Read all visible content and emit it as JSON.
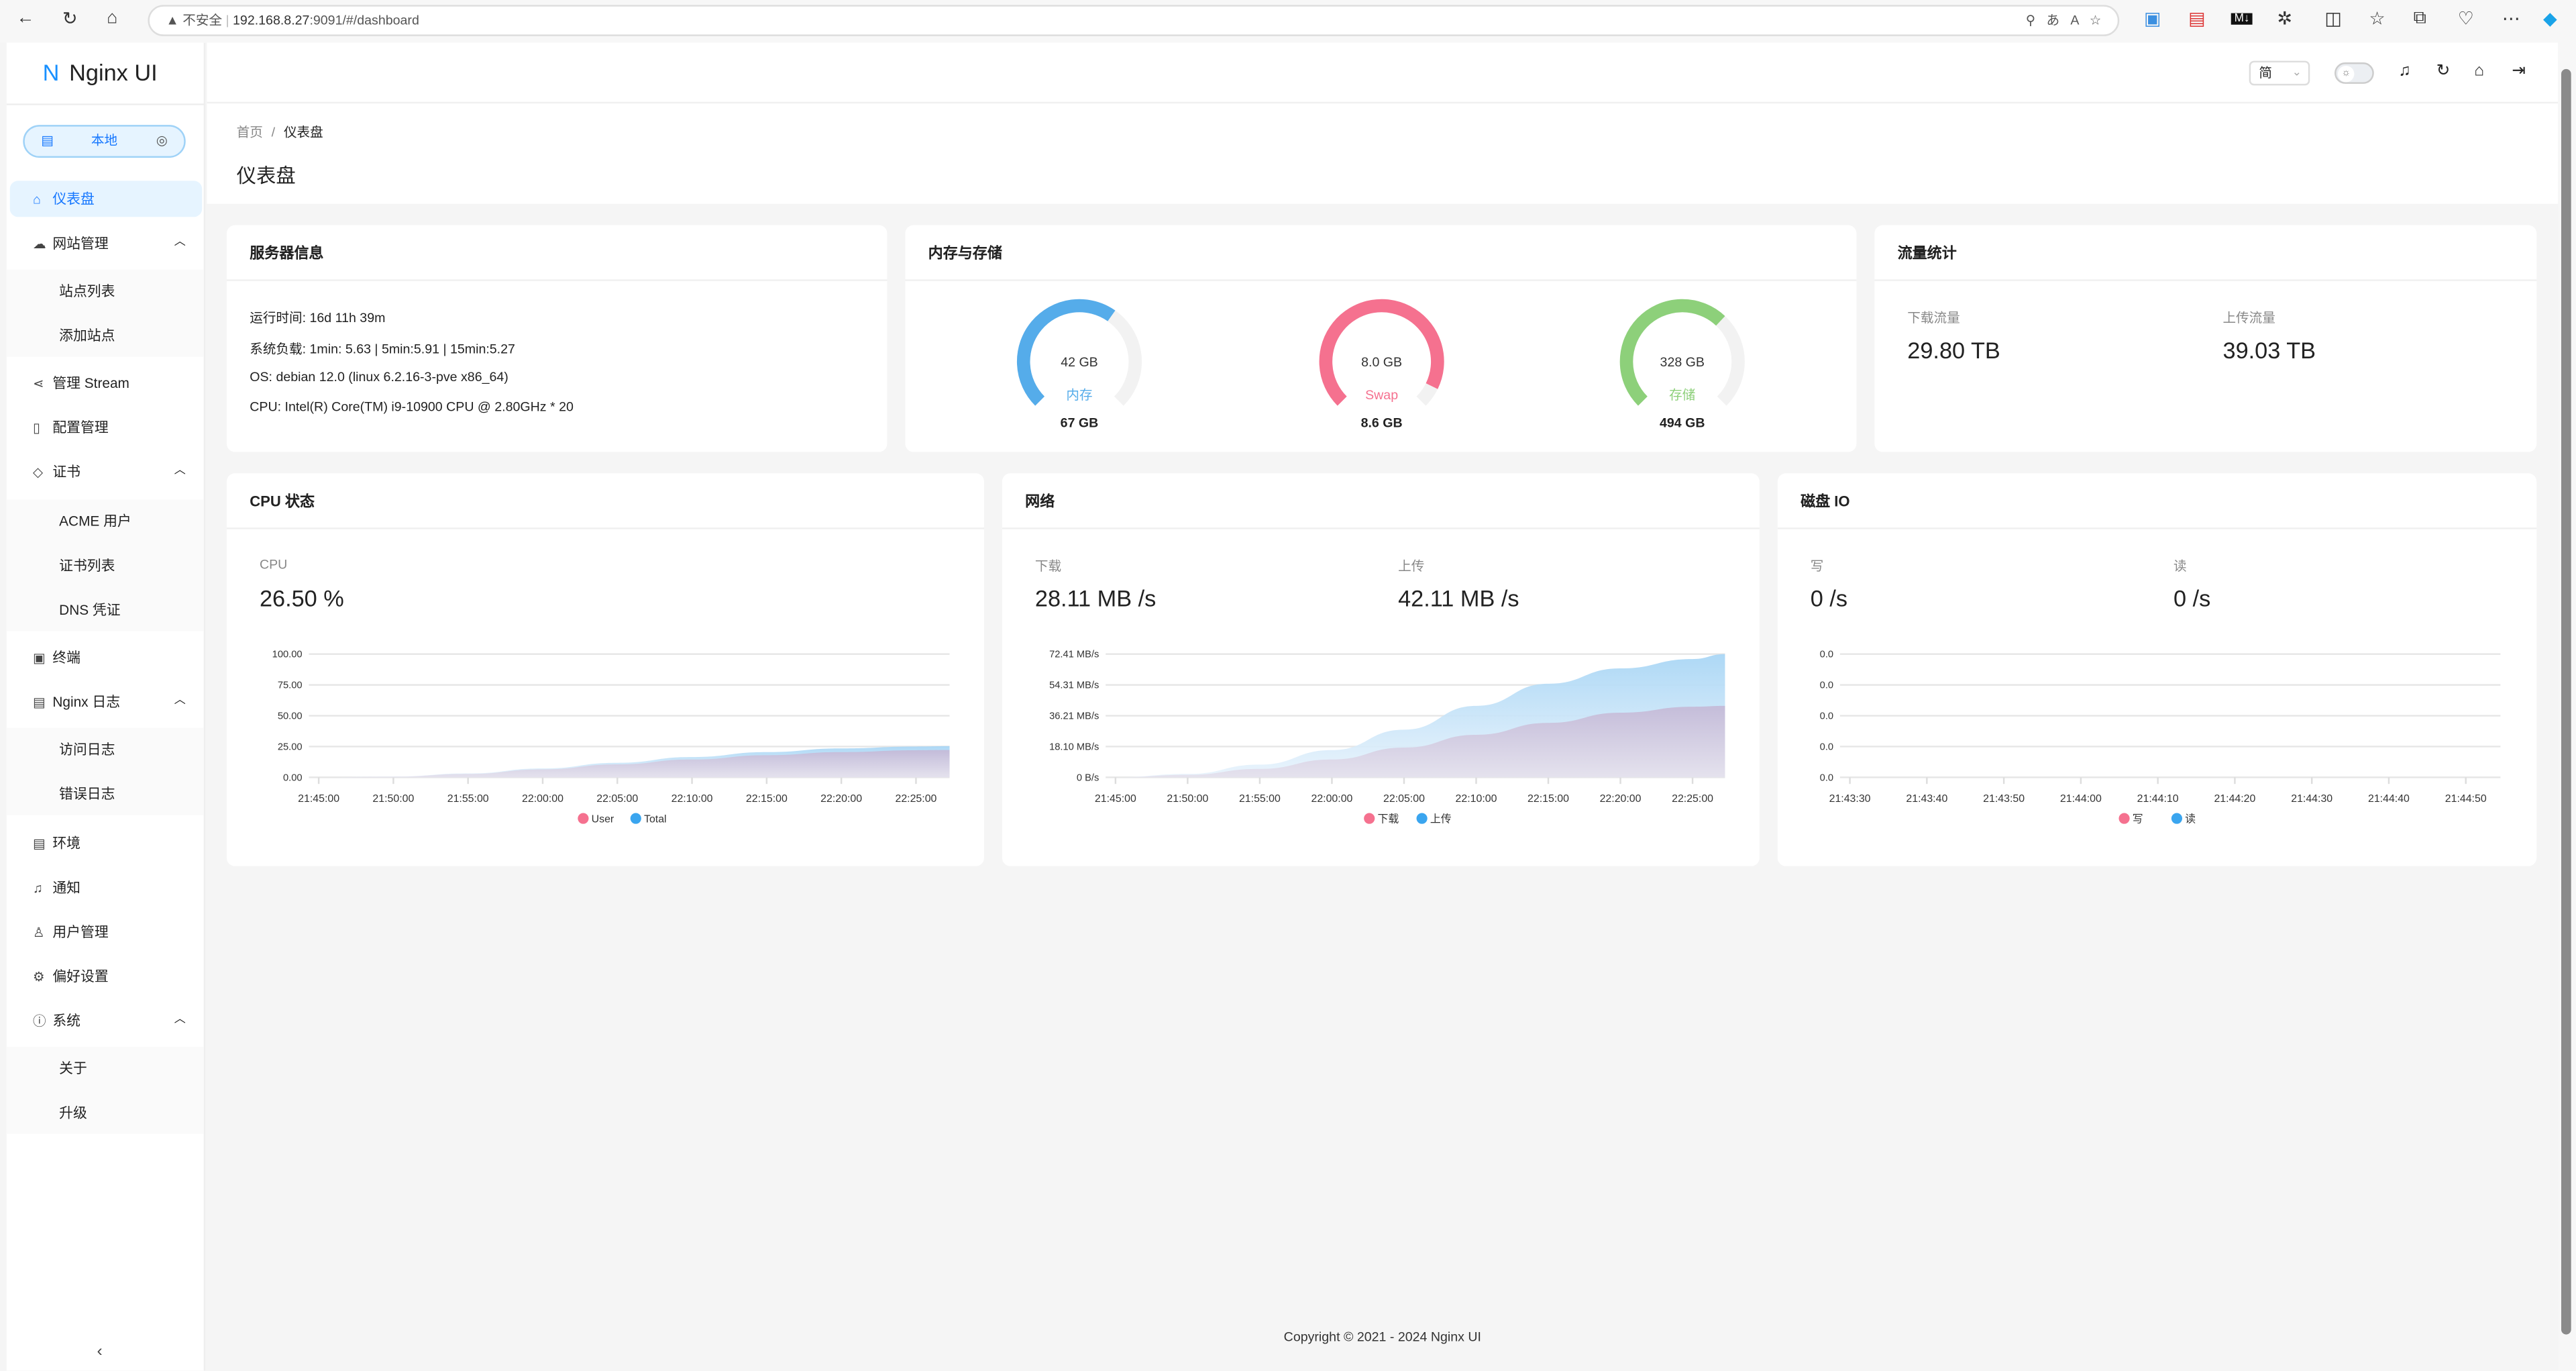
{
  "browser": {
    "insecure_label": "不安全",
    "url_host": "192.168.8.27",
    "url_rest": ":9091/#/dashboard"
  },
  "sidebar": {
    "logo": "Nginx UI",
    "logo_mark": "N",
    "env_label": "本地",
    "items": [
      {
        "label": "仪表盘",
        "icon": "home-icon",
        "active": true
      },
      {
        "label": "网站管理",
        "icon": "cloud-icon",
        "expanded": true
      },
      {
        "label": "站点列表",
        "sub": true
      },
      {
        "label": "添加站点",
        "sub": true
      },
      {
        "label": "管理 Stream",
        "icon": "share-icon"
      },
      {
        "label": "配置管理",
        "icon": "file-icon"
      },
      {
        "label": "证书",
        "icon": "shield-icon",
        "expanded": true
      },
      {
        "label": "ACME 用户",
        "sub": true
      },
      {
        "label": "证书列表",
        "sub": true
      },
      {
        "label": "DNS 凭证",
        "sub": true
      },
      {
        "label": "终端",
        "icon": "terminal-icon"
      },
      {
        "label": "Nginx 日志",
        "icon": "file-text-icon",
        "expanded": true
      },
      {
        "label": "访问日志",
        "sub": true
      },
      {
        "label": "错误日志",
        "sub": true
      },
      {
        "label": "环境",
        "icon": "database-icon"
      },
      {
        "label": "通知",
        "icon": "bell-icon"
      },
      {
        "label": "用户管理",
        "icon": "user-icon"
      },
      {
        "label": "偏好设置",
        "icon": "gear-icon"
      },
      {
        "label": "系统",
        "icon": "info-icon",
        "expanded": true
      },
      {
        "label": "关于",
        "sub": true
      },
      {
        "label": "升级",
        "sub": true
      }
    ]
  },
  "header": {
    "lang": "简"
  },
  "breadcrumb": {
    "home": "首页",
    "sep": "/",
    "current": "仪表盘"
  },
  "page_title": "仪表盘",
  "server_info": {
    "title": "服务器信息",
    "lines": [
      "运行时间: 16d 11h 39m",
      "系统负载: 1min: 5.63 | 5min:5.91 | 15min:5.27",
      "OS: debian 12.0 (linux 6.2.16-3-pve x86_64)",
      "CPU: Intel(R) Core(TM) i9-10900 CPU @ 2.80GHz * 20"
    ]
  },
  "memory": {
    "title": "内存与存储",
    "gauges": [
      {
        "value": "42 GB",
        "label": "内存",
        "total": "67 GB",
        "percent": 63,
        "color": "#55acea"
      },
      {
        "value": "8.0 GB",
        "label": "Swap",
        "total": "8.6 GB",
        "percent": 93,
        "color": "#f5718f"
      },
      {
        "value": "328 GB",
        "label": "存储",
        "total": "494 GB",
        "percent": 66,
        "color": "#8dd07a"
      }
    ]
  },
  "traffic": {
    "title": "流量统计",
    "download_label": "下载流量",
    "download": "29.80 TB",
    "upload_label": "上传流量",
    "upload": "39.03 TB"
  },
  "cpu": {
    "title": "CPU 状态",
    "label": "CPU",
    "value": "26.50 %"
  },
  "network": {
    "title": "网络",
    "download_label": "下载",
    "download": "28.11 MB /s",
    "upload_label": "上传",
    "upload": "42.11 MB /s"
  },
  "disk": {
    "title": "磁盘 IO",
    "write_label": "写",
    "write": "0 /s",
    "read_label": "读",
    "read": "0 /s"
  },
  "colors": {
    "series1": "#f5718f",
    "series2": "#3aa5ef"
  },
  "chart_data": [
    {
      "type": "area",
      "id": "cpu",
      "x": [
        "21:45:00",
        "21:50:00",
        "21:55:00",
        "22:00:00",
        "22:05:00",
        "22:10:00",
        "22:15:00",
        "22:20:00",
        "22:25:00",
        "22:27:00"
      ],
      "xticks": [
        "21:45:00",
        "21:50:00",
        "21:55:00",
        "22:00:00",
        "22:05:00",
        "22:10:00",
        "22:15:00",
        "22:20:00",
        "22:25:00"
      ],
      "yticks": [
        "0.00",
        "25.00",
        "50.00",
        "75.00",
        "100.00"
      ],
      "ylim": [
        0,
        100
      ],
      "series": [
        {
          "name": "User",
          "values": [
            0,
            0.5,
            2.8,
            6.5,
            10.5,
            14.5,
            18,
            20.5,
            22,
            22.2
          ]
        },
        {
          "name": "Total",
          "values": [
            0,
            0.6,
            3.2,
            7.2,
            11.8,
            16.5,
            20.5,
            23.5,
            25,
            25.3
          ]
        }
      ]
    },
    {
      "type": "area",
      "id": "net",
      "x": [
        "21:45:00",
        "21:50:00",
        "21:55:00",
        "22:00:00",
        "22:05:00",
        "22:10:00",
        "22:15:00",
        "22:20:00",
        "22:25:00",
        "22:27:00"
      ],
      "xticks": [
        "21:45:00",
        "21:50:00",
        "21:55:00",
        "22:00:00",
        "22:05:00",
        "22:10:00",
        "22:15:00",
        "22:20:00",
        "22:25:00"
      ],
      "yticks": [
        "0 B/s",
        "18.10 MB/s",
        "36.21 MB/s",
        "54.31 MB/s",
        "72.41 MB/s"
      ],
      "ylim": [
        0,
        72.41
      ],
      "series": [
        {
          "name": "下载",
          "values": [
            0,
            1.5,
            5,
            10.5,
            17.5,
            25,
            32,
            38,
            41.5,
            42
          ]
        },
        {
          "name": "上传",
          "values": [
            0,
            2,
            7.5,
            16,
            28,
            42,
            55,
            64,
            69.5,
            72.4
          ]
        }
      ]
    },
    {
      "type": "area",
      "id": "disk",
      "x": [
        "21:43:30",
        "21:43:40",
        "21:43:50",
        "21:44:00",
        "21:44:10",
        "21:44:20",
        "21:44:30",
        "21:44:40",
        "21:44:50",
        "21:44:56"
      ],
      "xticks": [
        "21:43:30",
        "21:43:40",
        "21:43:50",
        "21:44:00",
        "21:44:10",
        "21:44:20",
        "21:44:30",
        "21:44:40",
        "21:44:50"
      ],
      "yticks": [
        "0.0",
        "0.0",
        "0.0",
        "0.0",
        "0.0"
      ],
      "ylim": [
        0,
        1
      ],
      "series": [
        {
          "name": "写",
          "values": [
            0,
            0,
            0,
            0,
            0,
            0,
            0,
            0,
            0,
            0
          ]
        },
        {
          "name": "读",
          "values": [
            0,
            0,
            0,
            0,
            0,
            0,
            0,
            0,
            0,
            0
          ]
        }
      ]
    }
  ],
  "footer": "Copyright © 2021 - 2024 Nginx UI"
}
